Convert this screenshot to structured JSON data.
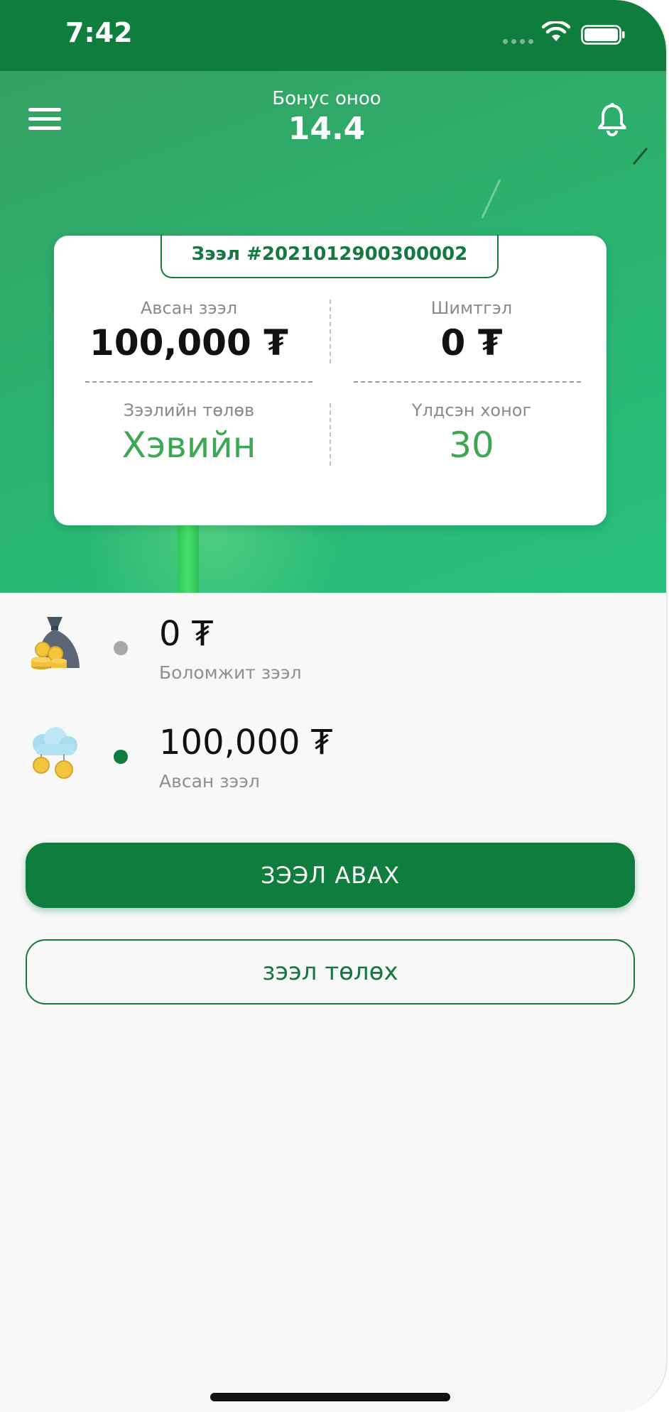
{
  "status_bar": {
    "time": "7:42"
  },
  "header": {
    "bonus_label": "Бонус оноо",
    "bonus_value": "14.4",
    "menu_icon": "hamburger-menu-icon",
    "notification_icon": "bell-icon"
  },
  "loan_card": {
    "loan_number": "Зээл #2021012900300002",
    "borrowed_label": "Авсан зээл",
    "borrowed_value": "100,000 ₮",
    "fee_label": "Шимтгэл",
    "fee_value": "0 ₮",
    "status_label": "Зээлийн төлөв",
    "status_value": "Хэвийн",
    "days_left_label": "Үлдсэн хоног",
    "days_left_value": "30"
  },
  "summary": [
    {
      "amount": "0 ₮",
      "label": "Боломжит зээл",
      "icon": "money-bag-coins-icon",
      "dot_color": "#a8a8a8"
    },
    {
      "amount": "100,000 ₮",
      "label": "Авсан зээл",
      "icon": "cloud-coins-icon",
      "dot_color": "#0f7d3d"
    }
  ],
  "actions": {
    "take_loan": "ЗЭЭЛ АВАХ",
    "pay_loan": "зээл төлөх"
  },
  "colors": {
    "primary": "#0f7d3d",
    "status_green": "#3ca853"
  }
}
